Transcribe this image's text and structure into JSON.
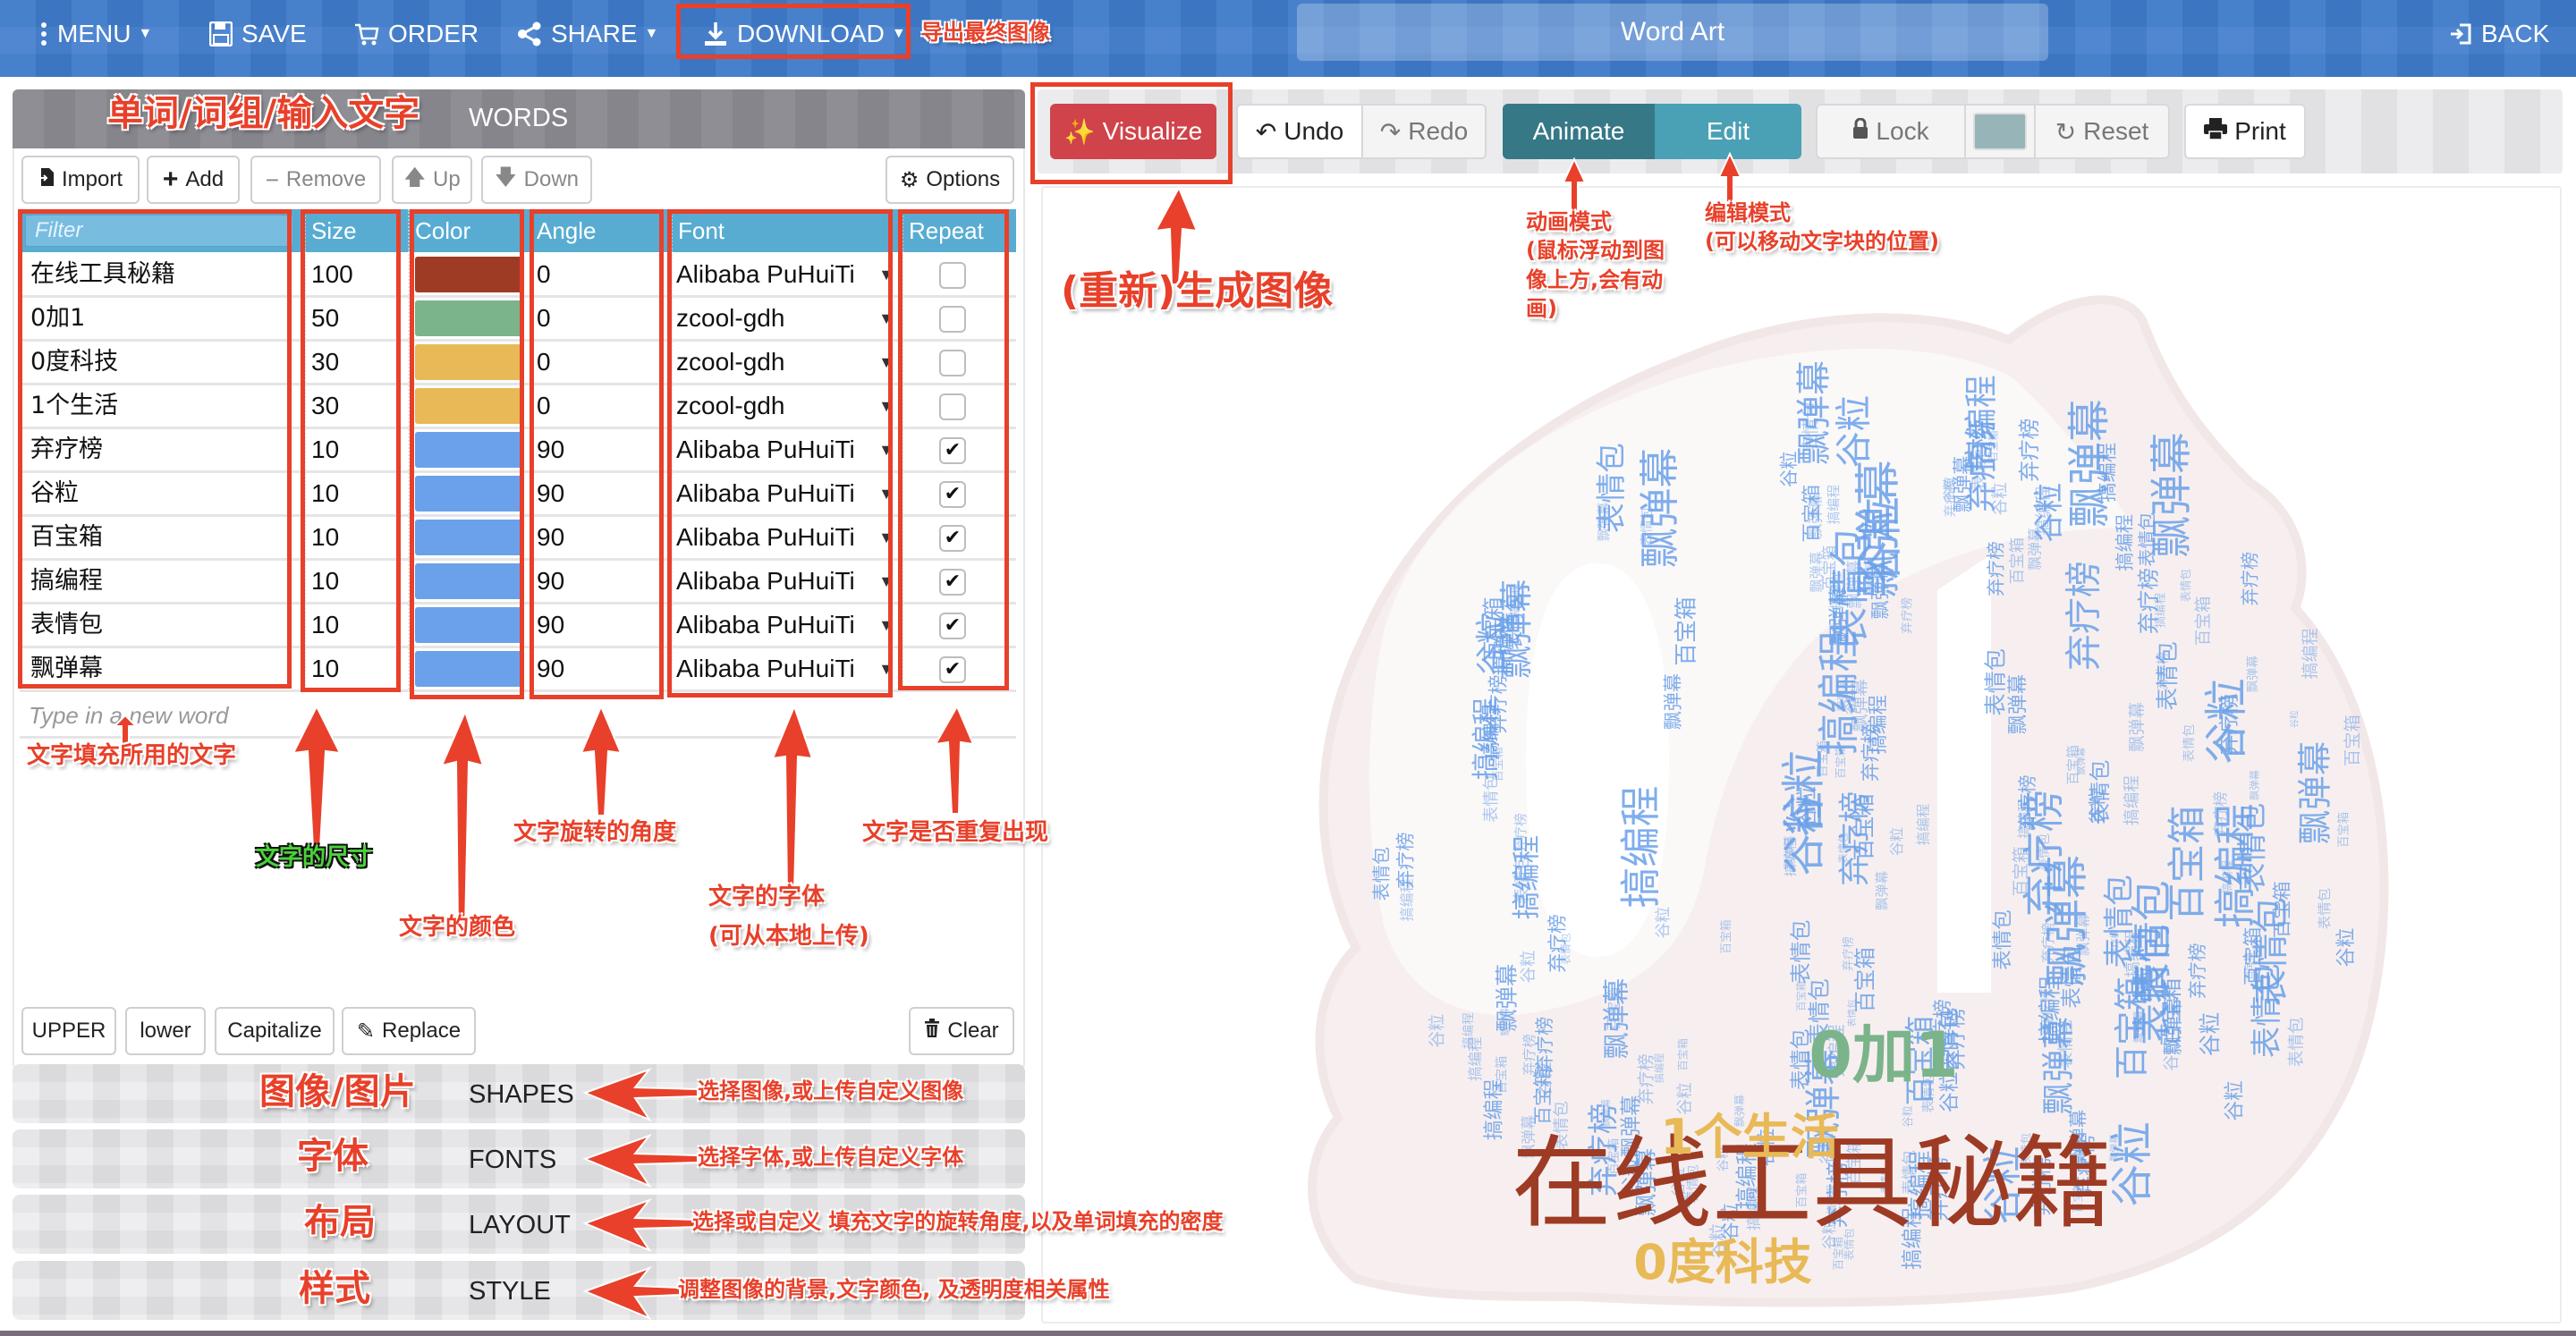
{
  "topbar": {
    "menu": "MENU",
    "save": "SAVE",
    "order": "ORDER",
    "share": "SHARE",
    "download": "DOWNLOAD",
    "title": "Word Art",
    "back": "BACK",
    "icons": {
      "menu": "vertical-ellipsis",
      "save": "floppy-disk",
      "order": "shopping-cart",
      "share": "share-nodes",
      "download": "download-arrow",
      "back": "sign-in"
    }
  },
  "words_panel": {
    "header": "WORDS",
    "buttons": {
      "import": "Import",
      "add": "Add",
      "remove": "Remove",
      "up": "Up",
      "down": "Down",
      "options": "Options"
    },
    "columns": {
      "filter_placeholder": "Filter",
      "size": "Size",
      "color": "Color",
      "angle": "Angle",
      "font": "Font",
      "repeat": "Repeat"
    },
    "rows": [
      {
        "word": "在线工具秘籍",
        "size": "100",
        "color": "#9e3b24",
        "angle": "0",
        "font": "Alibaba PuHuiTi",
        "repeat": false
      },
      {
        "word": "0加1",
        "size": "50",
        "color": "#7bb48a",
        "angle": "0",
        "font": "zcool-gdh",
        "repeat": false
      },
      {
        "word": "0度科技",
        "size": "30",
        "color": "#e8b957",
        "angle": "0",
        "font": "zcool-gdh",
        "repeat": false
      },
      {
        "word": "1个生活",
        "size": "30",
        "color": "#e8b957",
        "angle": "0",
        "font": "zcool-gdh",
        "repeat": false
      },
      {
        "word": "弃疗榜",
        "size": "10",
        "color": "#6aa1ea",
        "angle": "90",
        "font": "Alibaba PuHuiTi",
        "repeat": true
      },
      {
        "word": "谷粒",
        "size": "10",
        "color": "#6aa1ea",
        "angle": "90",
        "font": "Alibaba PuHuiTi",
        "repeat": true
      },
      {
        "word": "百宝箱",
        "size": "10",
        "color": "#6aa1ea",
        "angle": "90",
        "font": "Alibaba PuHuiTi",
        "repeat": true
      },
      {
        "word": "搞编程",
        "size": "10",
        "color": "#6aa1ea",
        "angle": "90",
        "font": "Alibaba PuHuiTi",
        "repeat": true
      },
      {
        "word": "表情包",
        "size": "10",
        "color": "#6aa1ea",
        "angle": "90",
        "font": "Alibaba PuHuiTi",
        "repeat": true
      },
      {
        "word": "飘弹幕",
        "size": "10",
        "color": "#6aa1ea",
        "angle": "90",
        "font": "Alibaba PuHuiTi",
        "repeat": true
      }
    ],
    "new_word_placeholder": "Type in a new word",
    "case_buttons": {
      "upper": "UPPER",
      "lower": "lower",
      "capitalize": "Capitalize",
      "replace": "Replace",
      "clear": "Clear"
    }
  },
  "sections": [
    {
      "label": "SHAPES"
    },
    {
      "label": "FONTS"
    },
    {
      "label": "LAYOUT"
    },
    {
      "label": "STYLE"
    }
  ],
  "toolbar": {
    "visualize": "Visualize",
    "undo": "Undo",
    "redo": "Redo",
    "animate": "Animate",
    "edit": "Edit",
    "lock": "Lock",
    "color_swatch": "#97b4b8",
    "reset": "Reset",
    "print": "Print"
  },
  "colors": {
    "topbar": "#3f7ccc",
    "visualize": "#d0434a",
    "animate": "#367886",
    "edit": "#4aa0b4",
    "table_header": "#58acd2",
    "annotation": "#e8402a"
  },
  "annotations": {
    "download": "导出最终图像",
    "words": "单词/词组/输入文字",
    "filter": "文字填充所用的文字",
    "size": "文字的尺寸",
    "color": "文字的颜色",
    "angle": "文字旋转的角度",
    "font_line1": "文字的字体",
    "font_line2": "(可从本地上传)",
    "repeat": "文字是否重复出现",
    "visualize": "(重新)生成图像",
    "animate_lines": [
      "动画模式",
      "(鼠标浮动到图",
      "像上方,会有动",
      "画)"
    ],
    "edit_lines": [
      "编辑模式",
      "(可以移动文字块的位置)"
    ],
    "shapes_cn": "图像/图片",
    "shapes_note": "选择图像,或上传自定义图像",
    "fonts_cn": "字体",
    "fonts_note": "选择字体,或上传自定义字体",
    "layout_cn": "布局",
    "layout_note": "选择或自定义 填充文字的旋转角度,以及单词填充的密度",
    "style_cn": "样式",
    "style_note": "调整图像的背景,文字颜色, 及透明度相关属性"
  },
  "wordcloud": {
    "main_words": [
      {
        "text": "在线工具秘籍",
        "color": "#9e3b24"
      },
      {
        "text": "0加1",
        "color": "#7bb48a"
      },
      {
        "text": "1个生活",
        "color": "#e8b957"
      },
      {
        "text": "0度科技",
        "color": "#e8b957"
      }
    ],
    "filler_words": [
      "弃疗榜",
      "谷粒",
      "百宝箱",
      "搞编程",
      "表情包",
      "飘弹幕"
    ],
    "filler_color": "#6aa1ea"
  }
}
